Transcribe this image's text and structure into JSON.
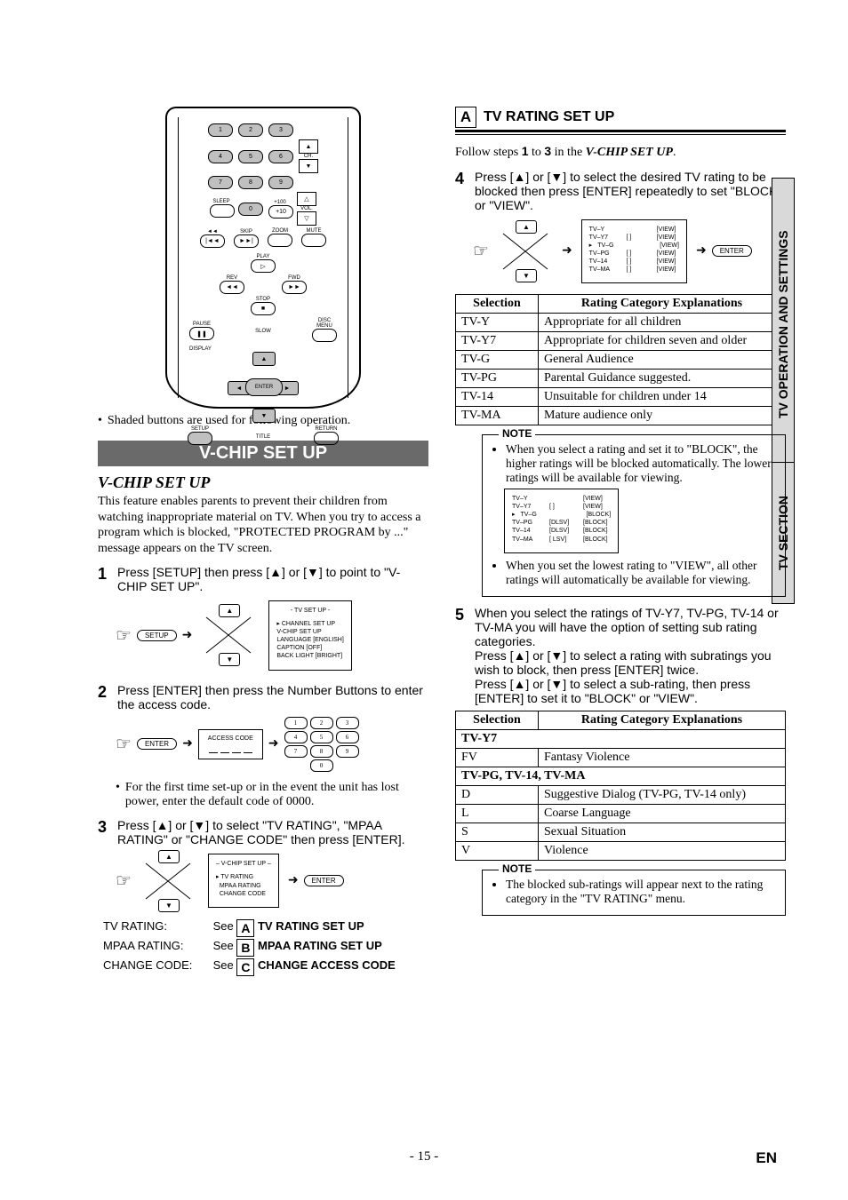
{
  "sidetabs": {
    "big": "TV OPERATION AND SETTINGS",
    "small": "TV SECTION"
  },
  "remote": {
    "numbers": [
      "1",
      "2",
      "3",
      "4",
      "5",
      "6",
      "7",
      "8",
      "9",
      "0",
      "+100",
      "+10"
    ],
    "labels": {
      "ch": "CH.",
      "vol": "VOL.",
      "sleep": "SLEEP",
      "skip": "SKIP",
      "zoom": "ZOOM",
      "mute": "MUTE",
      "play": "PLAY",
      "rev": "REV",
      "fwd": "FWD",
      "stop": "STOP",
      "pause": "PAUSE",
      "slow": "SLOW",
      "discmenu": "DISC\nMENU",
      "display": "DISPLAY",
      "setup": "SETUP",
      "title": "TITLE",
      "return": "RETURN",
      "enter": "ENTER"
    },
    "caption": "Shaded buttons are used for following operation."
  },
  "vchip": {
    "bar": "V-CHIP SET UP",
    "heading": "V-CHIP SET UP",
    "intro": "This feature enables parents to prevent their children from watching inappropriate material on TV. When you try to access a program which is blocked, \"PROTECTED PROGRAM by ...\" message appears on the TV screen.",
    "steps": {
      "1": "Press [SETUP] then press [▲] or [▼] to point to \"V-CHIP SET UP\".",
      "2": "Press [ENTER] then press the Number Buttons to enter the access code.",
      "2note": "For the first time set-up or in the event the unit has lost power, enter the default code of 0000.",
      "3": "Press [▲] or [▼] to select \"TV RATING\", \"MPAA RATING\" or \"CHANGE CODE\" then press [ENTER]."
    },
    "osd1": {
      "title": "- TV SET UP -",
      "items": [
        "CHANNEL SET UP",
        "V-CHIP SET UP",
        "LANGUAGE  [ENGLISH]",
        "CAPTION   [OFF]",
        "BACK LIGHT  [BRIGHT]"
      ]
    },
    "access": {
      "label": "ACCESS CODE"
    },
    "osd2": {
      "title": "– V-CHIP SET UP –",
      "items": [
        "TV RATING",
        "MPAA RATING",
        "CHANGE CODE"
      ]
    },
    "see": {
      "tv": {
        "l": "TV RATING:",
        "t": "See ",
        "b": "A",
        "r": " TV RATING SET UP"
      },
      "mp": {
        "l": "MPAA RATING:",
        "t": "See ",
        "b": "B",
        "r": " MPAA RATING SET UP"
      },
      "cc": {
        "l": "CHANGE CODE:",
        "t": "See ",
        "b": "C",
        "r": " CHANGE ACCESS CODE"
      }
    },
    "setup_label": "SETUP",
    "enter_label": "ENTER"
  },
  "sectionA": {
    "box": "A",
    "title": "TV RATING SET UP",
    "follow_pre": "Follow steps ",
    "follow_mid": " to ",
    "follow_post": " in the ",
    "follow_ref": "V-CHIP SET UP",
    "follow_suffix": ".",
    "s1": "1",
    "s3": "3",
    "step4": "Press [▲] or [▼] to select the desired TV rating to be blocked then press [ENTER] repeatedly to set \"BLOCK\" or \"VIEW\".",
    "osd": {
      "rows": [
        [
          "TV–Y",
          "",
          "[VIEW]"
        ],
        [
          "TV–Y7",
          "[        ]",
          "[VIEW]"
        ],
        [
          "TV–G",
          "",
          "[VIEW]"
        ],
        [
          "TV–PG",
          "[        ]",
          "[VIEW]"
        ],
        [
          "TV–14",
          "[        ]",
          "[VIEW]"
        ],
        [
          "TV–MA",
          "[        ]",
          "[VIEW]"
        ]
      ]
    },
    "table1": {
      "h1": "Selection",
      "h2": "Rating Category Explanations",
      "rows": [
        [
          "TV-Y",
          "Appropriate for all children"
        ],
        [
          "TV-Y7",
          "Appropriate for children seven and older"
        ],
        [
          "TV-G",
          "General Audience"
        ],
        [
          "TV-PG",
          "Parental Guidance suggested."
        ],
        [
          "TV-14",
          "Unsuitable for children under 14"
        ],
        [
          "TV-MA",
          "Mature audience only"
        ]
      ]
    },
    "note1": {
      "label": "NOTE",
      "b1": "When you select a rating and set it to \"BLOCK\", the higher ratings will be blocked automatically. The lower ratings will be available for viewing.",
      "osd": {
        "rows": [
          [
            "TV–Y",
            "",
            "[VIEW]"
          ],
          [
            "TV–Y7",
            "[        ]",
            "[VIEW]"
          ],
          [
            "TV–G",
            "",
            "[BLOCK]"
          ],
          [
            "TV–PG",
            "[DLSV]",
            "[BLOCK]"
          ],
          [
            "TV–14",
            "[DLSV]",
            "[BLOCK]"
          ],
          [
            "TV–MA",
            "[  LSV]",
            "[BLOCK]"
          ]
        ]
      },
      "b2": "When you set the lowest rating to \"VIEW\", all other ratings will automatically be available for viewing."
    },
    "step5a": "When you select the ratings of TV-Y7, TV-PG, TV-14 or TV-MA you will have the option of setting sub rating categories.",
    "step5b": "Press [▲] or [▼] to select a rating with subratings you wish to block, then press [ENTER] twice.",
    "step5c": "Press [▲] or [▼] to select a sub-rating, then press [ENTER] to set it to \"BLOCK\" or \"VIEW\".",
    "table2": {
      "h1": "Selection",
      "h2": "Rating Category Explanations",
      "g1": "TV-Y7",
      "r1": [
        "FV",
        "Fantasy Violence"
      ],
      "g2": "TV-PG, TV-14, TV-MA",
      "r2": [
        "D",
        "Suggestive Dialog    (TV-PG, TV-14 only)"
      ],
      "r3": [
        "L",
        "Coarse Language"
      ],
      "r4": [
        "S",
        "Sexual Situation"
      ],
      "r5": [
        "V",
        "Violence"
      ]
    },
    "note2": {
      "label": "NOTE",
      "b1": "The blocked sub-ratings will appear next to the rating category in the \"TV RATING\" menu."
    },
    "enter_label": "ENTER"
  },
  "footer": {
    "page": "- 15 -",
    "lang": "EN"
  }
}
